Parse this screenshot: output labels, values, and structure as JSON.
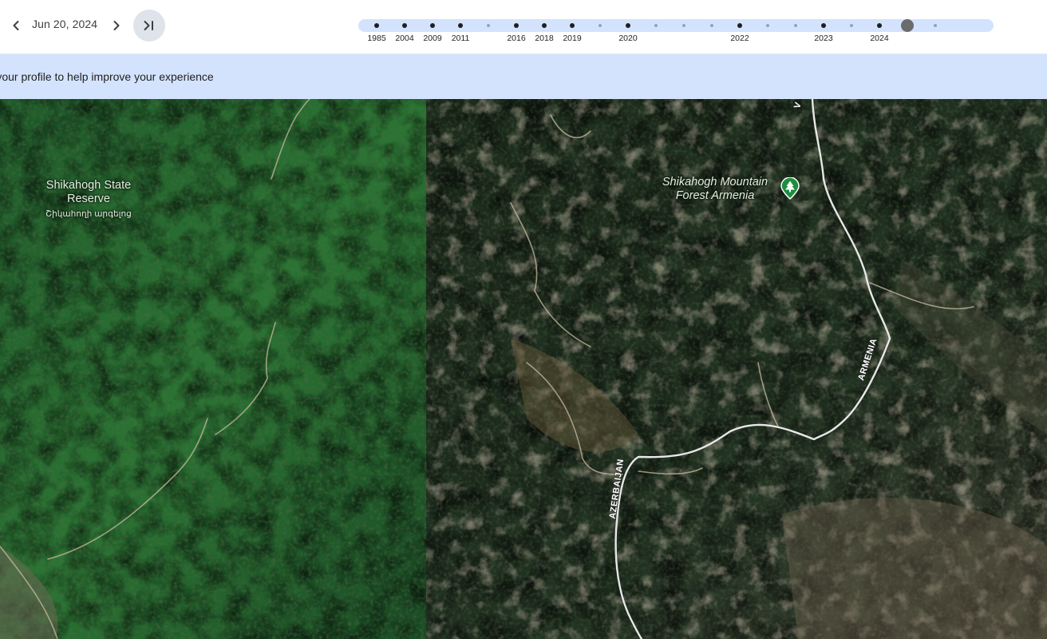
{
  "toolbar": {
    "date": "Jun 20, 2024",
    "prev_icon": "chevron-left-icon",
    "next_icon": "chevron-right-icon",
    "latest_icon": "skip-to-latest-icon"
  },
  "timeline": {
    "ticks": [
      {
        "label": "1985",
        "major": true
      },
      {
        "label": "2004",
        "major": true
      },
      {
        "label": "2009",
        "major": true
      },
      {
        "label": "2011",
        "major": true
      },
      {
        "label": "",
        "major": false
      },
      {
        "label": "2016",
        "major": true
      },
      {
        "label": "2018",
        "major": true
      },
      {
        "label": "2019",
        "major": true
      },
      {
        "label": "",
        "major": false
      },
      {
        "label": "2020",
        "major": true
      },
      {
        "label": "",
        "major": false
      },
      {
        "label": "",
        "major": false
      },
      {
        "label": "",
        "major": false
      },
      {
        "label": "2022",
        "major": true
      },
      {
        "label": "",
        "major": false
      },
      {
        "label": "",
        "major": false
      },
      {
        "label": "2023",
        "major": true
      },
      {
        "label": "",
        "major": false
      },
      {
        "label": "2024",
        "major": true
      },
      {
        "label": "",
        "major": false,
        "selected": true
      },
      {
        "label": "",
        "major": false
      }
    ],
    "selected_index": 19
  },
  "banner": {
    "text": "ete your profile to help improve your experience"
  },
  "map": {
    "reserve_name": "Shikahogh State Reserve",
    "reserve_name_local": "Շիկահողի արգելոց",
    "poi_name": "Shikahogh Mountain Forest Armenia",
    "poi_icon": "tree-marker-icon",
    "road_label_armenia": "ARMENIA",
    "road_label_azerbaijan": "AZERBAIJAN",
    "road_label_top": "V"
  },
  "colors": {
    "timeline_track": "#d3e3fd",
    "banner_bg": "#d3e3fd",
    "poi_marker": "#1e8e3e",
    "selected_tick": "#6b6b6b"
  }
}
